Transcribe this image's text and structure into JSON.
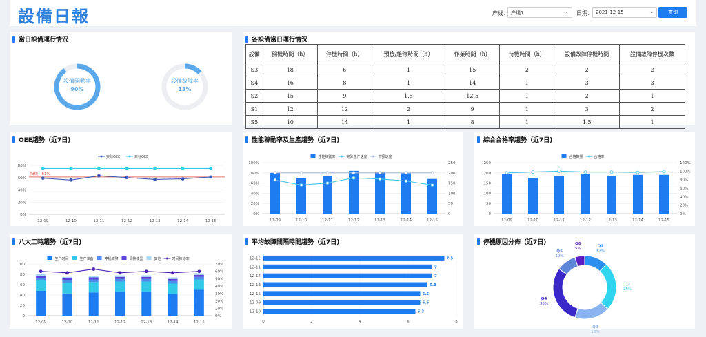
{
  "header": {
    "title": "設備日報",
    "line_label": "产线：",
    "line_value": "产线1",
    "date_label": "日期：",
    "date_value": "2021-12-15",
    "query_btn": "查询"
  },
  "gauge_panel": {
    "title": "當日設備運行情況",
    "gauges": [
      {
        "label": "設備開動率",
        "value": "90%",
        "fraction": 0.9,
        "color": "#5ba8ea"
      },
      {
        "label": "設備故障率",
        "value": "13%",
        "fraction": 0.13,
        "color": "#5ba8ea"
      }
    ]
  },
  "table_panel": {
    "title": "各設備當日運行情況",
    "columns": [
      "設備",
      "開機時間（h）",
      "停機時間（h）",
      "預檢/維修時間（h）",
      "作業時間（h）",
      "待機時間（h）",
      "設備故障停機時間",
      "設備故障停機次數"
    ],
    "rows": [
      [
        "S3",
        "18",
        "6",
        "1",
        "15",
        "2",
        "2",
        "2"
      ],
      [
        "S4",
        "16",
        "8",
        "1",
        "14",
        "1",
        "3",
        "3"
      ],
      [
        "S2",
        "15",
        "9",
        "1.5",
        "12.5",
        "1",
        "2",
        "1"
      ],
      [
        "S1",
        "12",
        "12",
        "2",
        "9",
        "1",
        "3",
        "2"
      ],
      [
        "S5",
        "10",
        "14",
        "1",
        "8",
        "1",
        "1.5",
        "1"
      ]
    ]
  },
  "oee": {
    "title": "OEE趨勢（近7日)",
    "chart_data": {
      "type": "line",
      "categories": [
        "12-09",
        "12-10",
        "12-11",
        "12-12",
        "12-13",
        "12-14",
        "12-15"
      ],
      "series": [
        {
          "name": "实际OEE",
          "color": "#3d58b4",
          "values": [
            59,
            56,
            63,
            60,
            57,
            58,
            61
          ]
        },
        {
          "name": "目标OEE",
          "color": "#2fd0e6",
          "values": [
            75,
            75,
            75,
            75,
            75,
            75,
            75
          ]
        }
      ],
      "yticks": [
        "0%",
        "20%",
        "40%",
        "60%",
        "80%"
      ],
      "ylim": [
        0,
        80
      ],
      "threshold": {
        "label": "阳线：61%",
        "value": 61,
        "color": "#e0503c"
      }
    }
  },
  "perf": {
    "title": "性能稼動率及生產趨勢（近7日)",
    "chart_data": {
      "type": "bar",
      "categories": [
        "12-09",
        "12-10",
        "12-11",
        "12-12",
        "12-13",
        "12-14",
        "12-15"
      ],
      "bars": {
        "name": "性能稼動率",
        "color": "#1f7bf0",
        "values": [
          80,
          69,
          74,
          84,
          82,
          79,
          68
        ]
      },
      "lines": [
        {
          "name": "实际生产速度",
          "color": "#48c4e8",
          "values": [
            165,
            140,
            150,
            175,
            170,
            160,
            140
          ]
        },
        {
          "name": "市额速度",
          "color": "#a9b9d8",
          "values": [
            200,
            200,
            200,
            200,
            200,
            200,
            200
          ]
        }
      ],
      "yticks_left": [
        "0%",
        "20%",
        "40%",
        "60%",
        "80%",
        "100%"
      ],
      "yticks_right": [
        "0",
        "50",
        "100",
        "150",
        "200",
        "250"
      ],
      "ylim_left": [
        0,
        100
      ],
      "ylim_right": [
        0,
        250
      ]
    }
  },
  "yield": {
    "title": "綜合合格率趨勢（近7日)",
    "chart_data": {
      "type": "bar",
      "categories": [
        "12-09",
        "12-10",
        "12-11",
        "12-12",
        "12-13",
        "12-14",
        "12-15"
      ],
      "bars": {
        "name": "合格数量",
        "color": "#1f7bf0",
        "values": [
          195,
          175,
          185,
          195,
          185,
          190,
          190
        ]
      },
      "lines": [
        {
          "name": "合格率",
          "color": "#48c4e8",
          "values": [
            96,
            98,
            100,
            98,
            98,
            97,
            99
          ]
        }
      ],
      "yticks_left": [
        "0",
        "50",
        "100",
        "150",
        "200",
        "250"
      ],
      "yticks_right": [
        "0%",
        "20%",
        "40%",
        "60%",
        "80%",
        "100%",
        "120%"
      ],
      "ylim_left": [
        0,
        250
      ],
      "ylim_right": [
        0,
        120
      ]
    }
  },
  "eight": {
    "title": "八大工時趨勢（近7日)",
    "chart_data": {
      "type": "bar",
      "categories": [
        "12-09",
        "12-10",
        "12-11",
        "12-12",
        "12-13",
        "12-14",
        "12-15"
      ],
      "stacks": [
        {
          "name": "生产时间",
          "color": "#1f7bf0",
          "values": [
            48,
            43,
            45,
            46,
            46,
            42,
            50
          ]
        },
        {
          "name": "生产准备",
          "color": "#33c7e8",
          "values": [
            20,
            20,
            20,
            20,
            20,
            20,
            20
          ]
        },
        {
          "name": "停机故障",
          "color": "#4d8de8",
          "values": [
            5,
            5,
            5,
            5,
            5,
            5,
            5
          ]
        },
        {
          "name": "调换模型",
          "color": "#5b42d8",
          "values": [
            4,
            4,
            4,
            4,
            4,
            4,
            4
          ]
        },
        {
          "name": "其他",
          "color": "#a6d8f7",
          "values": [
            3,
            3,
            3,
            3,
            3,
            3,
            3
          ]
        }
      ],
      "line": {
        "name": "时间稼动率",
        "color": "#4a1fb5",
        "values": [
          60,
          58,
          63,
          58,
          60,
          58,
          60
        ]
      },
      "yticks_left": [
        "0",
        "20",
        "40",
        "60",
        "80",
        "100"
      ],
      "yticks_right": [
        "0%",
        "10%",
        "20%",
        "30%",
        "40%",
        "50%",
        "60%",
        "70%"
      ],
      "ylim_left": [
        0,
        100
      ],
      "ylim_right": [
        0,
        70
      ]
    }
  },
  "mtbf": {
    "title": "平均故障間隔時間趨勢（近7日)",
    "chart_data": {
      "type": "bar",
      "orientation": "horizontal",
      "categories": [
        "12-12",
        "12-11",
        "12-14",
        "12-13",
        "12-15",
        "12-09",
        "12-10"
      ],
      "values": [
        7.5,
        7,
        7,
        6.8,
        6.5,
        6.5,
        6.3
      ],
      "color": "#1f7bf0",
      "xticks": [
        "0",
        "2",
        "4",
        "6",
        "8"
      ],
      "xlim": [
        0,
        8
      ]
    }
  },
  "reasons": {
    "title": "停機原因分佈（近7日)",
    "chart_data": {
      "type": "pie",
      "labels": [
        "Q1",
        "Q2",
        "Q3",
        "Q4",
        "Q5",
        "Q6"
      ],
      "values": [
        12,
        25,
        18,
        30,
        10,
        5
      ],
      "percent_labels": [
        "12%",
        "25%",
        "18%",
        "30%",
        "10%",
        "5%"
      ],
      "colors": [
        "#2c8ff0",
        "#2fd5ee",
        "#8ab4f0",
        "#3a28c8",
        "#5e86d6",
        "#5c1ec0"
      ]
    }
  }
}
